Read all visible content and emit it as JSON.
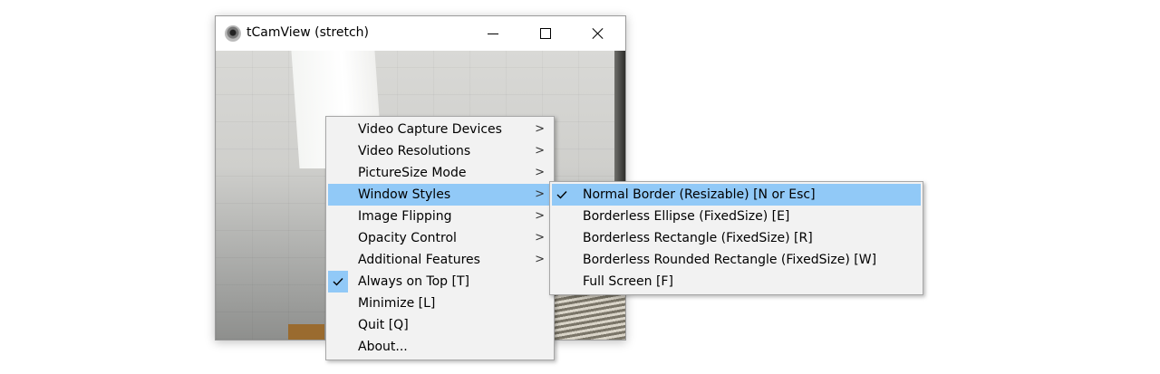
{
  "window": {
    "title": "tCamView (stretch)",
    "icon": "webcam-icon"
  },
  "context_menu": {
    "items": [
      {
        "label": "Video Capture Devices",
        "submenu": true,
        "checked": false,
        "highlighted": false
      },
      {
        "label": "Video Resolutions",
        "submenu": true,
        "checked": false,
        "highlighted": false
      },
      {
        "label": "PictureSize Mode",
        "submenu": true,
        "checked": false,
        "highlighted": false
      },
      {
        "label": "Window Styles",
        "submenu": true,
        "checked": false,
        "highlighted": true
      },
      {
        "label": "Image Flipping",
        "submenu": true,
        "checked": false,
        "highlighted": false
      },
      {
        "label": "Opacity Control",
        "submenu": true,
        "checked": false,
        "highlighted": false
      },
      {
        "label": "Additional Features",
        "submenu": true,
        "checked": false,
        "highlighted": false
      },
      {
        "label": "Always on Top [T]",
        "submenu": false,
        "checked": true,
        "highlighted": false
      },
      {
        "label": "Minimize [L]",
        "submenu": false,
        "checked": false,
        "highlighted": false
      },
      {
        "label": "Quit [Q]",
        "submenu": false,
        "checked": false,
        "highlighted": false
      },
      {
        "label": "About...",
        "submenu": false,
        "checked": false,
        "highlighted": false
      }
    ],
    "arrow_glyph": ">"
  },
  "window_styles_submenu": {
    "items": [
      {
        "label": "Normal Border (Resizable) [N or Esc]",
        "checked": true,
        "highlighted": true
      },
      {
        "label": "Borderless Ellipse (FixedSize) [E]",
        "checked": false,
        "highlighted": false
      },
      {
        "label": "Borderless Rectangle (FixedSize) [R]",
        "checked": false,
        "highlighted": false
      },
      {
        "label": "Borderless Rounded Rectangle (FixedSize) [W]",
        "checked": false,
        "highlighted": false
      },
      {
        "label": "Full Screen [F]",
        "checked": false,
        "highlighted": false
      }
    ]
  },
  "colors": {
    "highlight": "#91c9f7",
    "menu_background": "#f2f2f2"
  }
}
